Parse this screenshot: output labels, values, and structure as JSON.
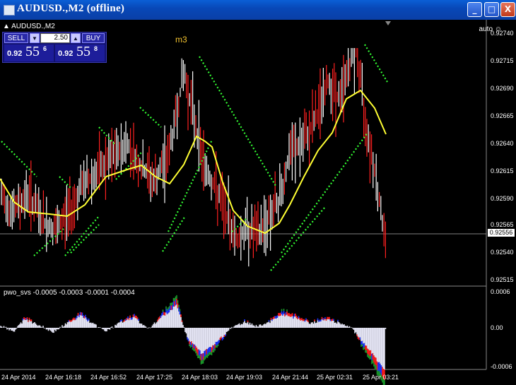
{
  "window": {
    "title": "AUDUSD.,M2 (offline)",
    "minimize_label": "_",
    "maximize_label": "□",
    "close_label": "X"
  },
  "chart": {
    "symbol_label": "▲ AUDUSD.,M2",
    "auto_label": "auto ☺",
    "annotation": "m3",
    "current_price": "0.92556",
    "price_ticks": [
      "0.92740",
      "0.92715",
      "0.92690",
      "0.92665",
      "0.92640",
      "0.92615",
      "0.92590",
      "0.92565",
      "0.92540",
      "0.92515"
    ],
    "time_labels": [
      "24 Apr 2014",
      "24 Apr 16:18",
      "24 Apr 16:52",
      "24 Apr 17:25",
      "24 Apr 18:03",
      "24 Apr 19:03",
      "24 Apr 21:44",
      "25 Apr 02:31",
      "25 Apr 03:21"
    ]
  },
  "trade_panel": {
    "sell_label": "SELL",
    "buy_label": "BUY",
    "lot_value": "2.50",
    "down_label": "▼",
    "up_label": "▲",
    "sell_price_small": "0.92",
    "sell_price_big": "55",
    "sell_price_sup": "6",
    "buy_price_small": "0.92",
    "buy_price_big": "55",
    "buy_price_sup": "8"
  },
  "indicator": {
    "label": "pwo_svs -0.0005 -0.0003 -0.0001 -0.0004",
    "ticks": [
      "0.0006",
      "0.00",
      "-0.0006"
    ]
  },
  "colors": {
    "bull_candle": "#ff2020",
    "bear_candle": "#ffffff",
    "ma_line": "#ffff33",
    "dots": "#33ff33",
    "hist_main": "#e8e8f8",
    "hist_red": "#ff1a1a",
    "hist_blue": "#1a33ff",
    "hist_green": "#1a9a2a"
  }
}
